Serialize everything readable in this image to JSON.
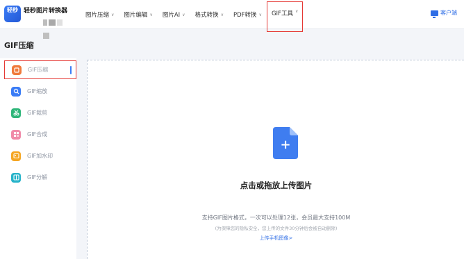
{
  "brand": {
    "logo_text": "轻秒",
    "name": "轻秒图片转换器"
  },
  "nav": {
    "items": [
      {
        "label": "图片压缩",
        "chevron": "∨"
      },
      {
        "label": "图片编辑",
        "chevron": "∨"
      },
      {
        "label": "图片AI",
        "chevron": "∨"
      },
      {
        "label": "格式转换",
        "chevron": "∨"
      },
      {
        "label": "PDF转换",
        "chevron": "∨"
      },
      {
        "label": "GIF工具",
        "chevron": "∨",
        "active": true
      }
    ],
    "client_label": "客户端"
  },
  "page": {
    "title": "GIF压缩"
  },
  "sidebar": {
    "items": [
      {
        "label": "GIF压缩",
        "icon": "compress-icon",
        "color": "#f07a3c",
        "active": true
      },
      {
        "label": "GIF缩放",
        "icon": "zoom-icon",
        "color": "#3a7cf6"
      },
      {
        "label": "GIF裁剪",
        "icon": "crop-icon",
        "color": "#2fb67a"
      },
      {
        "label": "GIF合成",
        "icon": "merge-icon",
        "color": "#f08aa8"
      },
      {
        "label": "GIF加水印",
        "icon": "watermark-icon",
        "color": "#f5a623"
      },
      {
        "label": "GIF分解",
        "icon": "split-icon",
        "color": "#27b3c9"
      }
    ]
  },
  "upload": {
    "plus_symbol": "+",
    "title": "点击或拖放上传图片",
    "description": "支持GIF图片格式，一次可以处理12张，会员最大支持100M",
    "note": "(为保障您的隐私安全，您上传的文件30分钟后会被自动删除)",
    "link": "上传手机图像>"
  },
  "colors": {
    "accent": "#2f6ee6",
    "highlight_border": "#e53935"
  }
}
